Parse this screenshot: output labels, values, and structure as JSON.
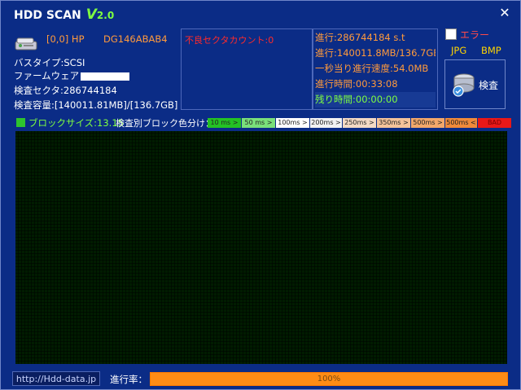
{
  "window": {
    "title": "HDD SCAN",
    "version_major": "V",
    "version_num": "2.0",
    "close": "✕"
  },
  "drive": {
    "id": "[0,0] HP",
    "model": "DG146ABAB4",
    "bus_type": "バスタイプ:SCSI",
    "firmware_label": "ファームウェア",
    "sectors": "検査セクタ:286744184",
    "capacity": "検査容量:[140011.81MB]/[136.7GB]"
  },
  "bad_sectors": {
    "label": "不良セクタカウント:0"
  },
  "stats": {
    "progress": "進行:286744184 s.t",
    "progress_size": "進行:140011.8MB/136.7GB",
    "speed": "一秒当り進行速度:54.0MB",
    "elapsed": "進行時間:00:33:08",
    "remaining": "残り時間:00:00:00"
  },
  "options": {
    "error_label": "エラー",
    "jpg": "JPG",
    "bmp": "BMP",
    "scan_button": "検査"
  },
  "legend": {
    "block_size": "ブロックサイズ:13.15",
    "color_by_label": "検査別ブロック色分け：",
    "items": [
      {
        "label": "10 ms >",
        "color": "#24c224"
      },
      {
        "label": "50 ms >",
        "color": "#7ae07a"
      },
      {
        "label": "100ms >",
        "color": "#ffffff"
      },
      {
        "label": "200ms >",
        "color": "#f2f2f2"
      },
      {
        "label": "250ms >",
        "color": "#f3d9c4"
      },
      {
        "label": "350ms >",
        "color": "#f3c39a"
      },
      {
        "label": "500ms >",
        "color": "#f2a76a"
      },
      {
        "label": "500ms <",
        "color": "#f08a3a"
      },
      {
        "label": "BAD",
        "color": "#e81818"
      }
    ]
  },
  "footer": {
    "url": "http://Hdd-data.jp",
    "progress_label": "進行率：",
    "progress_text": "100%",
    "progress_value": 1.0
  }
}
